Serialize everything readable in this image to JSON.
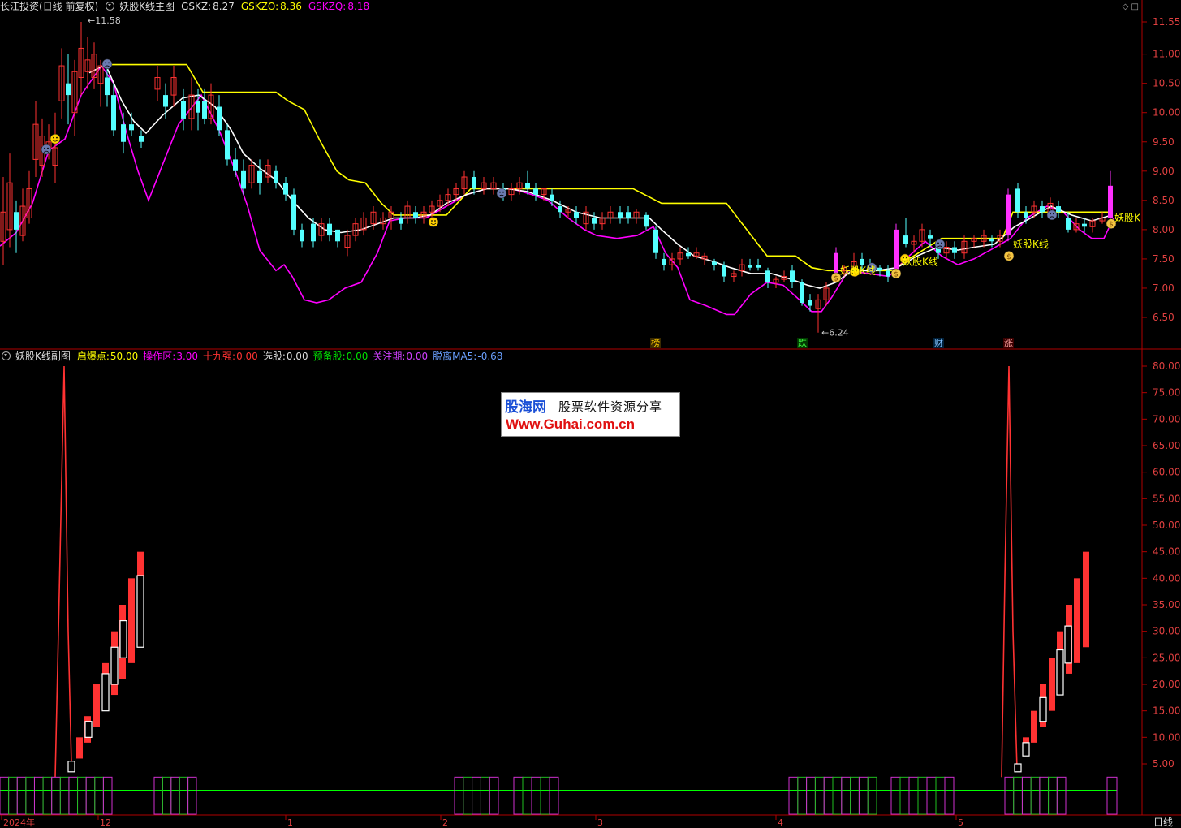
{
  "main_header": {
    "app": "长江投资(日线 前复权)",
    "indicator": "妖股K线主图",
    "gskz_label": "GSKZ:",
    "gskz_value": "8.27",
    "gskzo_label": "GSKZO:",
    "gskzo_value": "8.36",
    "gskzq_label": "GSKZQ:",
    "gskzq_value": "8.18"
  },
  "sub_header": {
    "indicator": "妖股K线副图",
    "qbd_label": "启爆点:",
    "qbd_value": "50.00",
    "czq_label": "操作区:",
    "czq_value": "3.00",
    "sjq_label": "十九强:",
    "sjq_value": "0.00",
    "xg_label": "选股:",
    "xg_value": "0.00",
    "ybg_label": "预备股:",
    "ybg_value": "0.00",
    "gzq_label": "关注期:",
    "gzq_value": "0.00",
    "tl_label": "脱离MA5:",
    "tl_value": "-0.68"
  },
  "top_right_controls": "◇ □",
  "price_axis": [
    "11.55",
    "11.00",
    "10.50",
    "10.00",
    "9.50",
    "9.00",
    "8.50",
    "8.00",
    "7.50",
    "7.00",
    "6.50"
  ],
  "sub_axis": [
    "80.00",
    "75.00",
    "70.00",
    "65.00",
    "60.00",
    "55.00",
    "50.00",
    "45.00",
    "40.00",
    "35.00",
    "30.00",
    "25.00",
    "20.00",
    "15.00",
    "10.00",
    "5.00"
  ],
  "date_axis": [
    "2024年",
    "12",
    "1",
    "2",
    "3",
    "4",
    "5"
  ],
  "period_label": "日线",
  "annotations": {
    "high": "11.58",
    "low": "6.24",
    "yaogu1": "妖股K线",
    "yaogu2": "妖股K线",
    "yaogu3": "妖股K线",
    "yaogu4": "妖股K",
    "event1": "榜",
    "event2": "跌",
    "event3": "财",
    "event4": "涨"
  },
  "watermark": {
    "brand": "股海网",
    "slogan": "股票软件资源分享",
    "url": "Www.Guhai.com.cn"
  },
  "colors": {
    "up": "#ff3232",
    "down": "#54ffff",
    "white_line": "#ffffff",
    "yellow_line": "#ffff00",
    "magenta_line": "#ff00ff",
    "green_line": "#00ff00",
    "axis": "#b00000"
  }
}
